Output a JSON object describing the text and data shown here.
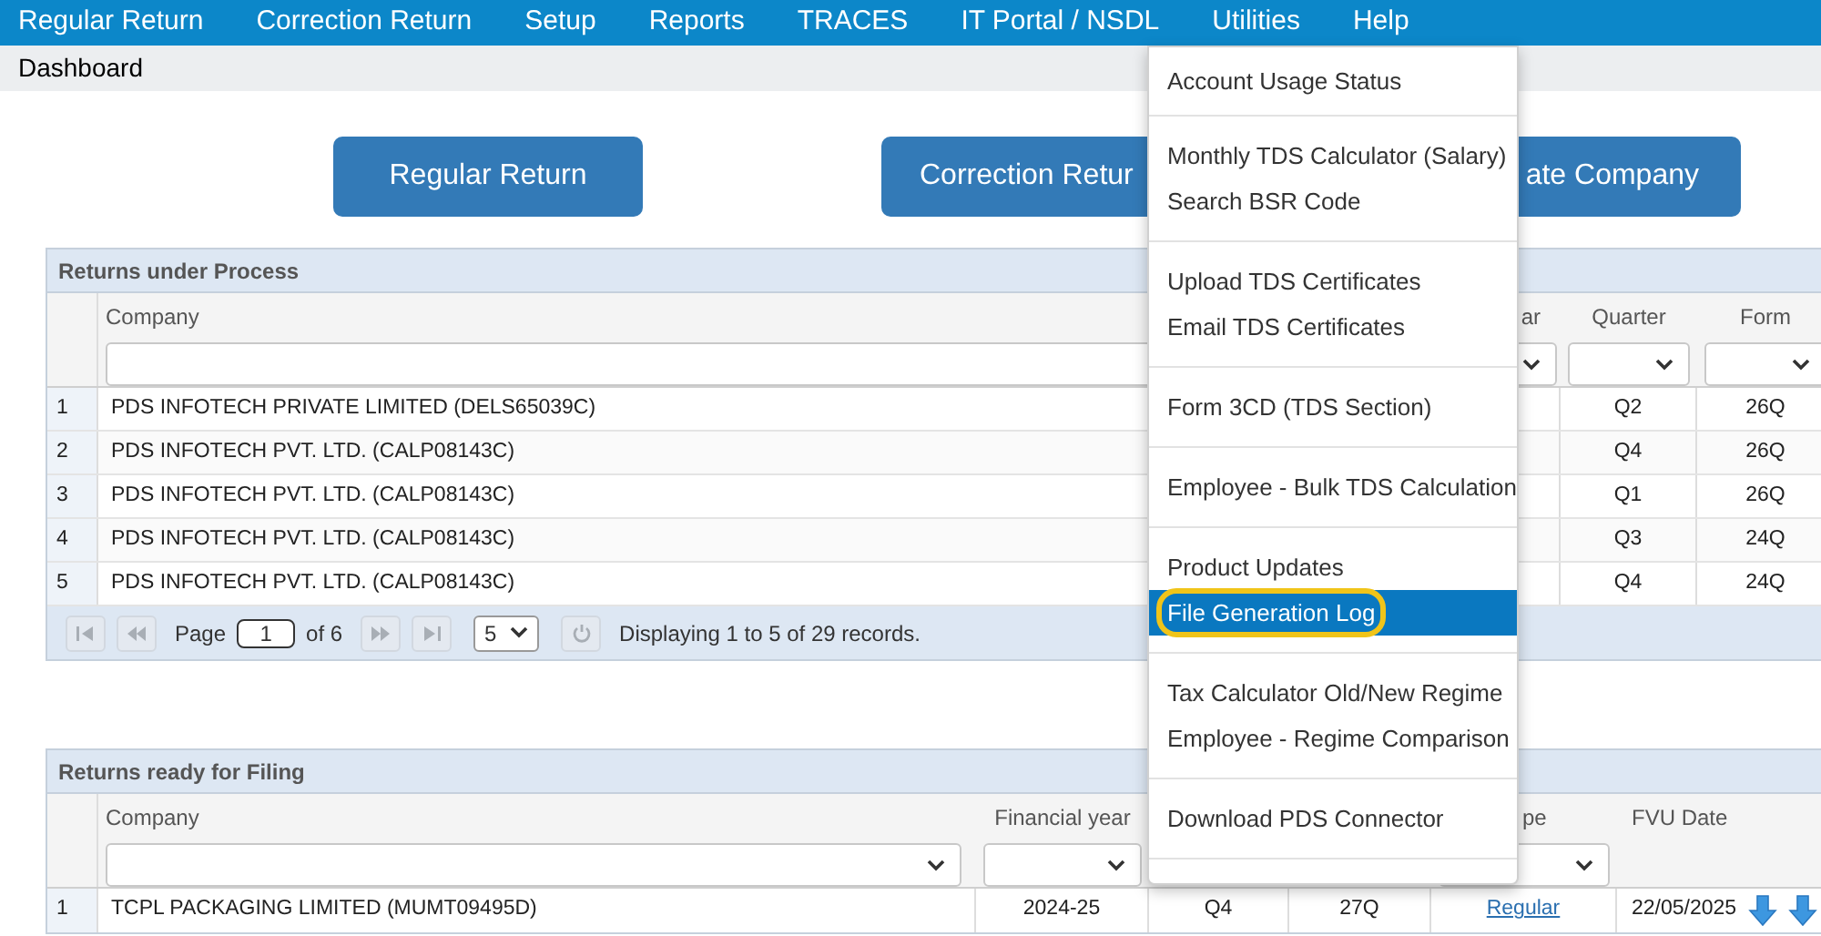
{
  "menu_bar": [
    {
      "label": "Regular Return"
    },
    {
      "label": "Correction Return"
    },
    {
      "label": "Setup"
    },
    {
      "label": "Reports"
    },
    {
      "label": "TRACES"
    },
    {
      "label": "IT Portal / NSDL"
    },
    {
      "label": "Utilities"
    },
    {
      "label": "Help"
    }
  ],
  "breadcrumb": "Dashboard",
  "actions": [
    "Regular Return",
    "Correction Retur",
    "ate Company"
  ],
  "returns_under_process": {
    "title": "Returns under Process",
    "columns": [
      "Company",
      "ar",
      "Quarter",
      "Form"
    ],
    "rows": [
      {
        "index": "1",
        "company": "PDS INFOTECH PRIVATE LIMITED (DELS65039C)",
        "quarter": "Q2",
        "form": "26Q"
      },
      {
        "index": "2",
        "company": "PDS INFOTECH PVT. LTD. (CALP08143C)",
        "quarter": "Q4",
        "form": "26Q"
      },
      {
        "index": "3",
        "company": "PDS INFOTECH PVT. LTD. (CALP08143C)",
        "quarter": "Q1",
        "form": "26Q"
      },
      {
        "index": "4",
        "company": "PDS INFOTECH PVT. LTD. (CALP08143C)",
        "quarter": "Q3",
        "form": "24Q"
      },
      {
        "index": "5",
        "company": "PDS INFOTECH PVT. LTD. (CALP08143C)",
        "quarter": "Q4",
        "form": "24Q"
      }
    ],
    "pager": {
      "page_label": "Page",
      "page": "1",
      "page_count": "of 6",
      "page_size": "5",
      "status": "Displaying 1 to 5 of 29 records."
    }
  },
  "returns_ready": {
    "title": "Returns ready for Filing",
    "columns": [
      "Company",
      "Financial year",
      "pe",
      "FVU Date"
    ],
    "rows": [
      {
        "index": "1",
        "company": "TCPL PACKAGING LIMITED (MUMT09495D)",
        "financial_year": "2024-25",
        "quarter": "Q4",
        "form": "27Q",
        "type": "Regular",
        "fvu_date": "22/05/2025"
      }
    ]
  },
  "utilities_menu": {
    "groups": [
      [
        {
          "label": "Account Usage Status",
          "selected": false,
          "circled": false
        }
      ],
      [
        {
          "label": "Monthly TDS Calculator (Salary)",
          "selected": false,
          "circled": false
        },
        {
          "label": "Search BSR Code",
          "selected": false,
          "circled": false
        }
      ],
      [
        {
          "label": "Upload TDS Certificates",
          "selected": false,
          "circled": false
        },
        {
          "label": "Email TDS Certificates",
          "selected": false,
          "circled": false
        }
      ],
      [
        {
          "label": "Form 3CD (TDS Section)",
          "selected": false,
          "circled": false
        }
      ],
      [
        {
          "label": "Employee - Bulk TDS Calculation",
          "selected": false,
          "circled": false
        }
      ],
      [
        {
          "label": "Product Updates",
          "selected": false,
          "circled": false
        },
        {
          "label": "File Generation Log",
          "selected": true,
          "circled": true
        }
      ],
      [
        {
          "label": "Tax Calculator Old/New Regime",
          "selected": false,
          "circled": false
        },
        {
          "label": "Employee - Regime Comparison",
          "selected": false,
          "circled": false
        }
      ],
      [
        {
          "label": "Download PDS Connector",
          "selected": false,
          "circled": false
        }
      ]
    ]
  }
}
